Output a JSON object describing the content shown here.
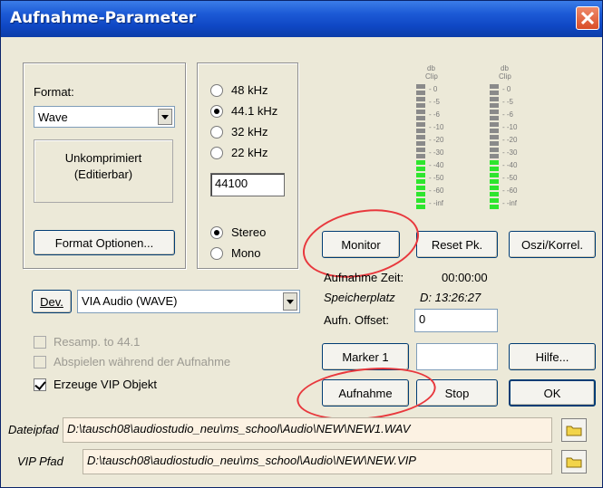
{
  "window": {
    "title": "Aufnahme-Parameter"
  },
  "format": {
    "label": "Format:",
    "selected": "Wave",
    "compression_line1": "Unkomprimiert",
    "compression_line2": "(Editierbar)",
    "options_button": "Format Optionen..."
  },
  "sample_rate": {
    "options": [
      "48 kHz",
      "44.1 kHz",
      "32 kHz",
      "22 kHz"
    ],
    "selected": "44.1 kHz",
    "custom_value": "44100"
  },
  "channels": {
    "options": [
      "Stereo",
      "Mono"
    ],
    "selected": "Stereo"
  },
  "meters": {
    "header_db": "db",
    "header_clip": "Clip",
    "scale": [
      "0",
      "-5",
      "-6",
      "-10",
      "-20",
      "-30",
      "-40",
      "-50",
      "-60",
      "-inf"
    ]
  },
  "buttons": {
    "monitor": "Monitor",
    "reset_pk": "Reset Pk.",
    "oszi": "Oszi/Korrel.",
    "marker": "Marker 1",
    "hilfe": "Hilfe...",
    "aufnahme": "Aufnahme",
    "stop": "Stop",
    "ok": "OK",
    "dev": "Dev."
  },
  "info": {
    "aufnahme_zeit_label": "Aufnahme Zeit:",
    "aufnahme_zeit_value": "00:00:00",
    "speicherplatz_label": "Speicherplatz",
    "speicherplatz_value": "D: 13:26:27",
    "offset_label": "Aufn. Offset:",
    "offset_value": "0",
    "marker_value": ""
  },
  "device": {
    "selected": "VIA Audio (WAVE)"
  },
  "checkboxes": {
    "resamp": "Resamp. to 44.1",
    "abspielen": "Abspielen während der Aufnahme",
    "vip": "Erzeuge VIP Objekt"
  },
  "paths": {
    "dateipfad_label": "Dateipfad",
    "dateipfad_value": "D:\\tausch08\\audiostudio_neu\\ms_school\\Audio\\NEW\\NEW1.WAV",
    "vip_label": "VIP Pfad",
    "vip_value": "D:\\tausch08\\audiostudio_neu\\ms_school\\Audio\\NEW\\NEW.VIP"
  },
  "colors": {
    "title_bar": "#0f47c4",
    "meter_green": "#2ee52e",
    "meter_gray": "#8a8a8a",
    "highlight": "#e8383d"
  }
}
